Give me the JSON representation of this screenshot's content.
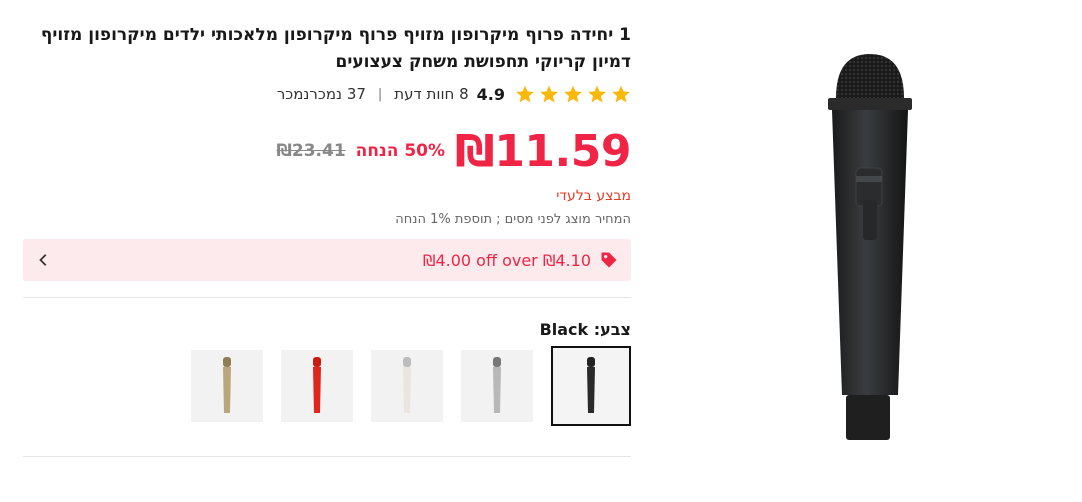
{
  "product": {
    "title": "1 יחידה פרוף מיקרופון מזויף פרוף מיקרופון מלאכותי ילדים מיקרופון מזויף דמיון קריוקי תחפושת משחק צעצועים",
    "rating": "4.9",
    "reviews": "8 חוות דעת",
    "sold": "37 נמכרנמכר",
    "star_color": "#f9b90c",
    "price": "₪11.59",
    "discount": "50% הנחה",
    "original_price": "₪23.41",
    "exclusive": "מבצע בלעדי",
    "tax_note": "המחיר מוצג לפני מסים ; תוספת 1% הנחה",
    "coupon": "₪4.00 off over ₪4.10",
    "accent_color": "#f02546",
    "color_label": "צבע: Black",
    "swatches": [
      {
        "name": "black",
        "color": "#2a2a2a",
        "selected": true
      },
      {
        "name": "silver",
        "color": "#b8b8b8",
        "selected": false
      },
      {
        "name": "white",
        "color": "#e9e6df",
        "selected": false
      },
      {
        "name": "red",
        "color": "#e0261c",
        "selected": false
      },
      {
        "name": "gold",
        "color": "#b9a67a",
        "selected": false
      }
    ]
  }
}
